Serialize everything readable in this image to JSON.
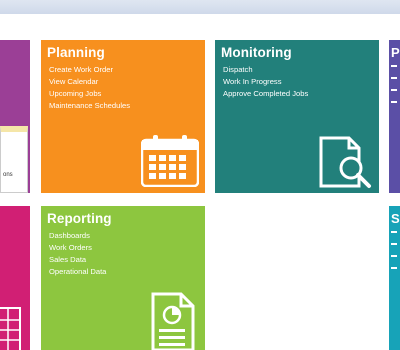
{
  "tiles": {
    "left_top": {
      "partial_text": "ons"
    },
    "planning": {
      "title": "Planning",
      "links": [
        "Create Work Order",
        "View Calendar",
        "Upcoming Jobs",
        "Maintenance Schedules"
      ],
      "icon": "calendar-icon"
    },
    "monitoring": {
      "title": "Monitoring",
      "links": [
        "Dispatch",
        "Work In Progress",
        "Approve Completed Jobs"
      ],
      "icon": "document-search-icon"
    },
    "right_top": {
      "title_partial": "P"
    },
    "reporting": {
      "title": "Reporting",
      "links": [
        "Dashboards",
        "Work Orders",
        "Sales Data",
        "Operational Data"
      ],
      "icon": "report-pie-icon"
    },
    "right_bottom": {
      "title_partial": "S"
    }
  },
  "colors": {
    "purple": "#9b3f96",
    "orange": "#f7901e",
    "teal": "#22807b",
    "indigo": "#5b4fa6",
    "pink": "#d11f74",
    "green": "#8dc63f",
    "cyan": "#17a3b8"
  }
}
